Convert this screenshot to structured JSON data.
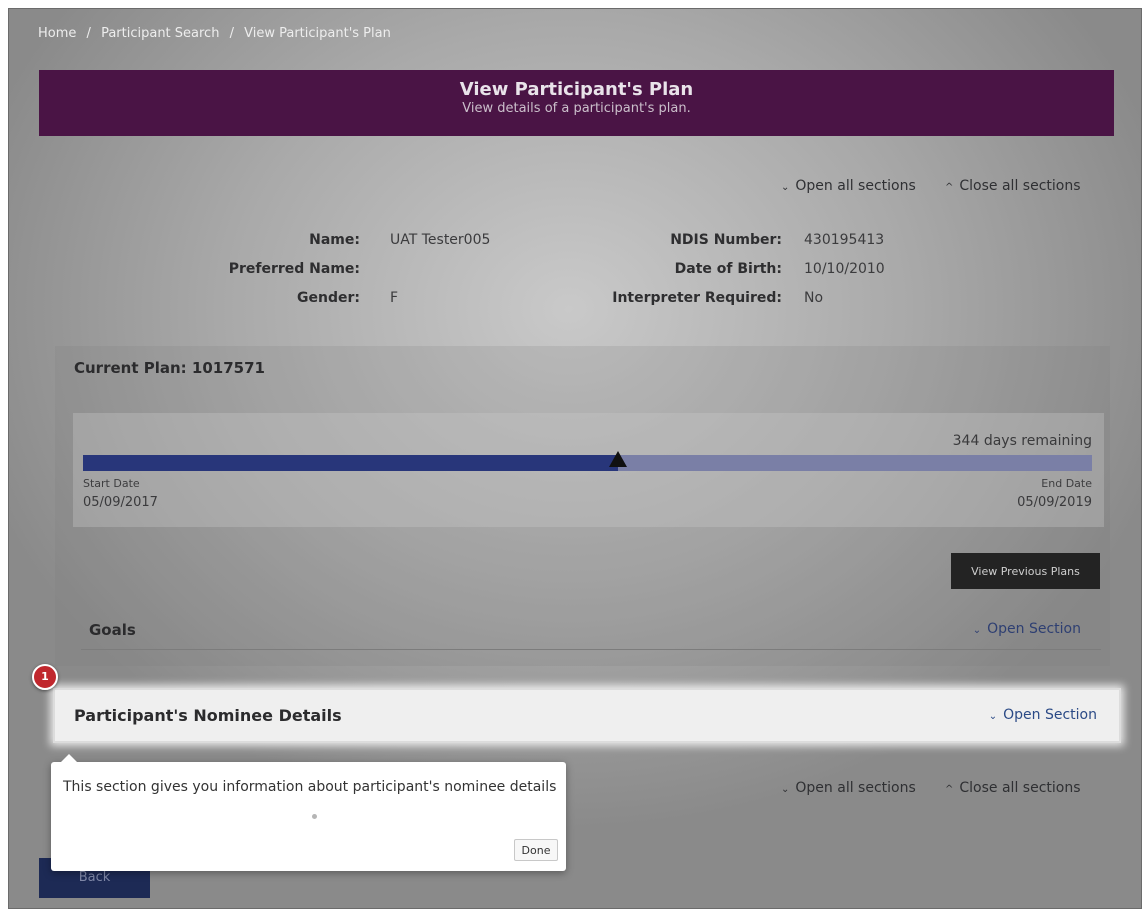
{
  "breadcrumb": {
    "home": "Home",
    "sep1": "/",
    "participant_search": "Participant Search",
    "sep2": "/",
    "current": "View Participant's Plan"
  },
  "header": {
    "title": "View Participant's Plan",
    "subtitle": "View details of a participant's plan."
  },
  "section_controls": {
    "open_all": "Open all sections",
    "close_all": "Close all sections",
    "open_icon": "chevron-down-icon",
    "close_icon": "chevron-up-icon"
  },
  "participant": {
    "name_label": "Name:",
    "name_value": "UAT Tester005",
    "preferred_label": "Preferred Name:",
    "preferred_value": "",
    "gender_label": "Gender:",
    "gender_value": "F",
    "ndis_label": "NDIS Number:",
    "ndis_value": "430195413",
    "dob_label": "Date of Birth:",
    "dob_value": "10/10/2010",
    "interpreter_label": "Interpreter Required:",
    "interpreter_value": "No"
  },
  "plan": {
    "title": "Current Plan: 1017571",
    "remaining": "344 days remaining",
    "progress_fraction": 0.53,
    "start_label": "Start Date",
    "start_value": "05/09/2017",
    "end_label": "End Date",
    "end_value": "05/09/2019",
    "view_previous": "View Previous Plans"
  },
  "sections": {
    "goals_title": "Goals",
    "goals_link": "Open Section",
    "nominee_title": "Participant's Nominee Details",
    "nominee_link": "Open Section"
  },
  "tour": {
    "step": "1",
    "text": "This section gives you information about participant's nominee details",
    "done": "Done"
  },
  "footer": {
    "back": "Back"
  },
  "colors": {
    "header_bg": "#4a1445",
    "bar_fill": "#28367a",
    "bar_track": "#7a7fa6",
    "badge": "#c0272d",
    "link": "#2b4a86"
  }
}
